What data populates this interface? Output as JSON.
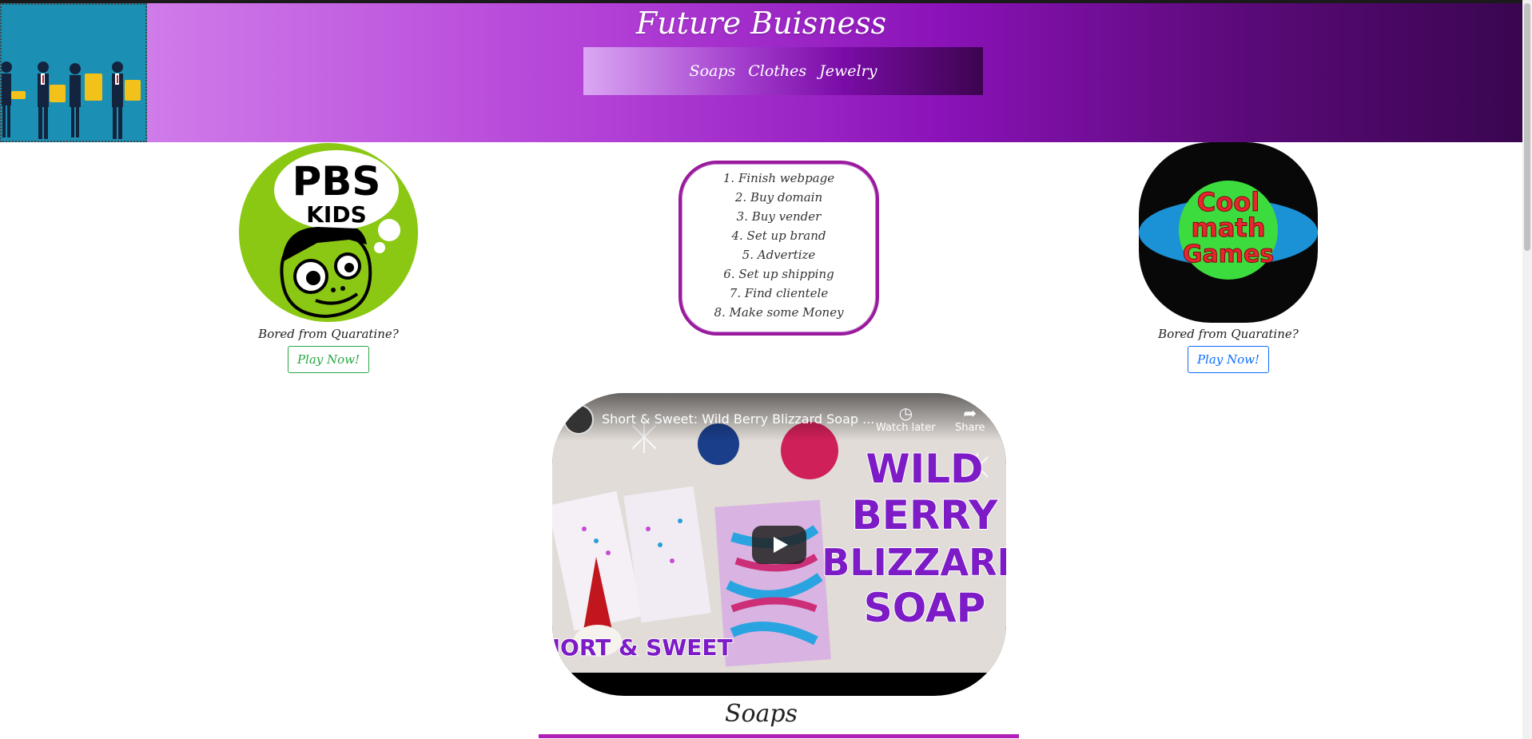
{
  "header": {
    "title": "Future Buisness",
    "nav": [
      "Soaps",
      "Clothes",
      "Jewelry"
    ]
  },
  "promo_left": {
    "logo_text": [
      "PBS",
      "KIDS"
    ],
    "caption": "Bored from Quaratine?",
    "button": "Play Now!",
    "button_color": "#28a745"
  },
  "promo_right": {
    "logo_text": [
      "Cool",
      "math",
      "Games"
    ],
    "caption": "Bored from Quaratine?",
    "button": "Play Now!",
    "button_color": "#0d6efd"
  },
  "todo": [
    "1. Finish webpage",
    "2. Buy domain",
    "3. Buy vender",
    "4. Set up brand",
    "5. Advertize",
    "6. Set up shipping",
    "7. Find clientele",
    "8. Make some Money"
  ],
  "video": {
    "title": "Short & Sweet: Wild Berry Blizzard Soap ...",
    "watch_later": "Watch later",
    "share": "Share",
    "thumb_words": [
      "WILD",
      "BERRY",
      "BLIZZARD",
      "SOAP"
    ],
    "thumb_tag": "SHORT & SWEET"
  },
  "section": {
    "title": "Soaps"
  },
  "colors": {
    "accent": "#b020b8",
    "header_dark": "#3a0550",
    "header_light": "#d98ff0"
  }
}
